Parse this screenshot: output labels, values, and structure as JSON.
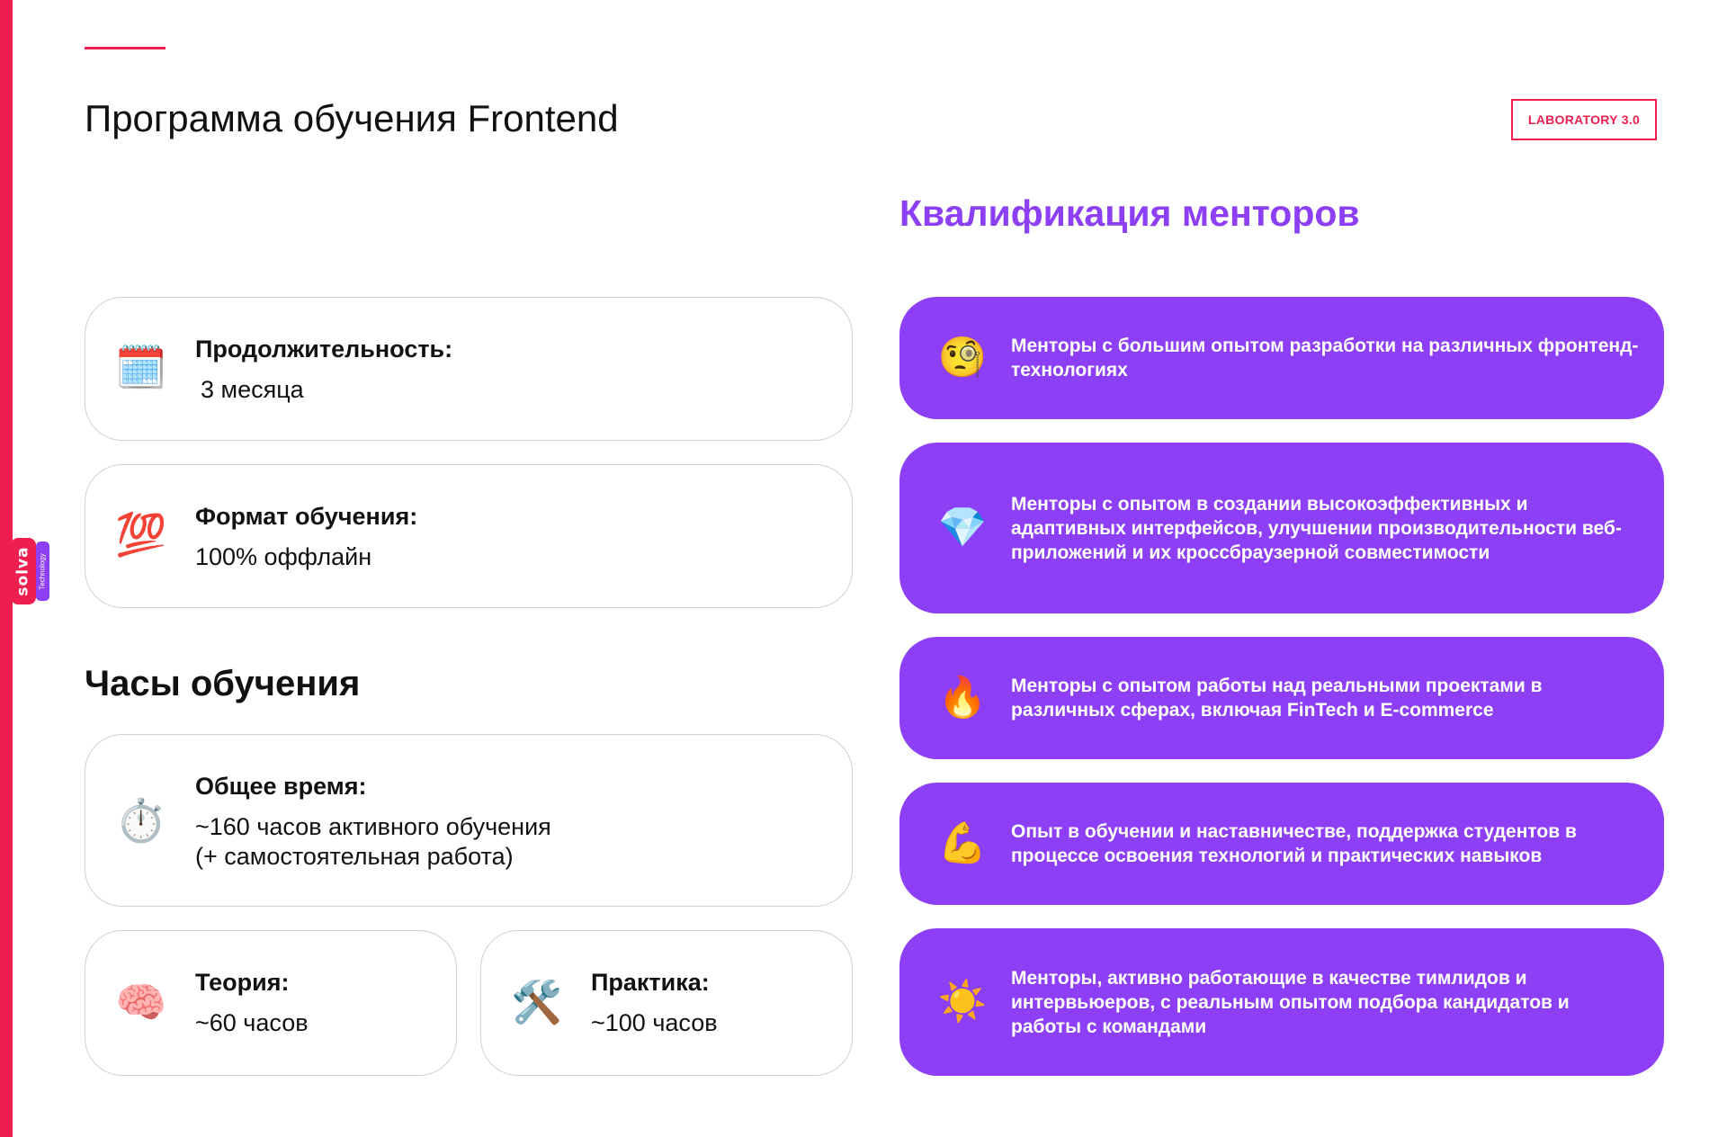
{
  "page": {
    "title": "Программа обучения Frontend",
    "badge": "LABORATORY 3.0"
  },
  "logo": {
    "text": "solva",
    "tagline": "Technology"
  },
  "program": {
    "duration": {
      "icon": "calendar-icon",
      "emoji": "🗓️",
      "label": "Продолжительность:",
      "value": "3 месяца"
    },
    "format": {
      "icon": "hundred-points-icon",
      "emoji": "💯",
      "label": "Формат обучения:",
      "value": "100% оффлайн"
    }
  },
  "hours": {
    "heading": "Часы обучения",
    "total": {
      "icon": "stopwatch-icon",
      "emoji": "⏱️",
      "label": "Общее время:",
      "value_line1": "~160 часов активного обучения",
      "value_line2": "(+ самостоятельная работа)"
    },
    "theory": {
      "icon": "brain-icon",
      "emoji": "🧠",
      "label": "Теория:",
      "value": "~60 часов"
    },
    "practice": {
      "icon": "hammer-wrench-icon",
      "emoji": "🛠️",
      "label": "Практика:",
      "value": "~100 часов"
    }
  },
  "mentors": {
    "heading": "Квалификация менторов",
    "items": [
      {
        "icon": "monocle-face-icon",
        "emoji": "🧐",
        "text": "Менторы с большим опытом разработки на различных фронтенд-технологиях"
      },
      {
        "icon": "gem-icon",
        "emoji": "💎",
        "text": "Менторы с опытом в создании высокоэффективных и адаптивных интерфейсов, улучшении производительности веб-приложений и их кроссбраузерной совместимости"
      },
      {
        "icon": "fire-icon",
        "emoji": "🔥",
        "text": "Менторы с опытом работы над реальными проектами в различных сферах, включая FinTech и E-commerce"
      },
      {
        "icon": "flexed-biceps-icon",
        "emoji": "💪",
        "text": "Опыт в обучении и наставничестве, поддержка студентов в процессе освоения технологий и практических навыков"
      },
      {
        "icon": "sun-icon",
        "emoji": "☀️",
        "text": "Менторы, активно работающие в качестве тимлидов и интервьюеров, с реальным опытом подбора кандидатов и работы с командами"
      }
    ]
  },
  "colors": {
    "accent_red": "#ee1f4f",
    "accent_purple": "#8c3ff5",
    "card_border": "#cfcfd6"
  }
}
